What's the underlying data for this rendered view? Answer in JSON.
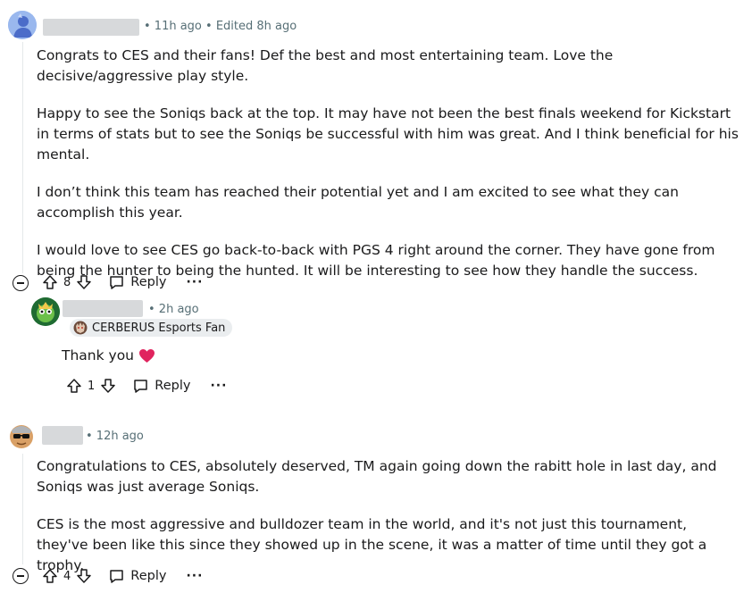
{
  "comment1": {
    "avatar_icon": "avatar-default-icon",
    "meta": "• 11h ago • Edited 8h ago",
    "paragraphs": [
      "Congrats to CES and their fans! Def the best and most entertaining team. Love the decisive/aggressive play style.",
      "Happy to see the Soniqs back at the top. It may have not been the best finals weekend for Kickstart in terms of stats but to see the Soniqs be successful with him was great. And I think beneficial for his mental.",
      "I don’t think this team has reached their potential yet and I am excited to see what they can accomplish this year.",
      "I would love to see CES go back-to-back with PGS 4 right around the corner. They have gone from being the hunter to being the hunted. It will be interesting to see how they handle the success."
    ],
    "score": "8",
    "reply_label": "Reply",
    "more_label": "···"
  },
  "reply1": {
    "avatar_icon": "avatar-green-character-icon",
    "meta": "• 2h ago",
    "flair": "CERBERUS Esports Fan",
    "flair_icon": "cerberus-logo-icon",
    "text": "Thank you",
    "emoji_icon": "red-heart-icon",
    "score": "1",
    "reply_label": "Reply",
    "more_label": "···"
  },
  "comment2": {
    "avatar_icon": "avatar-sunglasses-character-icon",
    "meta": "• 12h ago",
    "paragraphs": [
      "Congratulations to CES, absolutely deserved, TM again going down the rabitt hole in last day, and Soniqs was just average Soniqs.",
      "CES is the most aggressive and bulldozer team in the world, and it's not just this tournament, they've been like this since they showed up in the scene, it was a matter of time until they got a trophy."
    ],
    "score": "4",
    "reply_label": "Reply",
    "more_label": "···"
  },
  "colors": {
    "text": "#1a1a1b",
    "meta": "#576f76",
    "thread_line": "#e5e8ea",
    "heart": "#e0245e"
  }
}
